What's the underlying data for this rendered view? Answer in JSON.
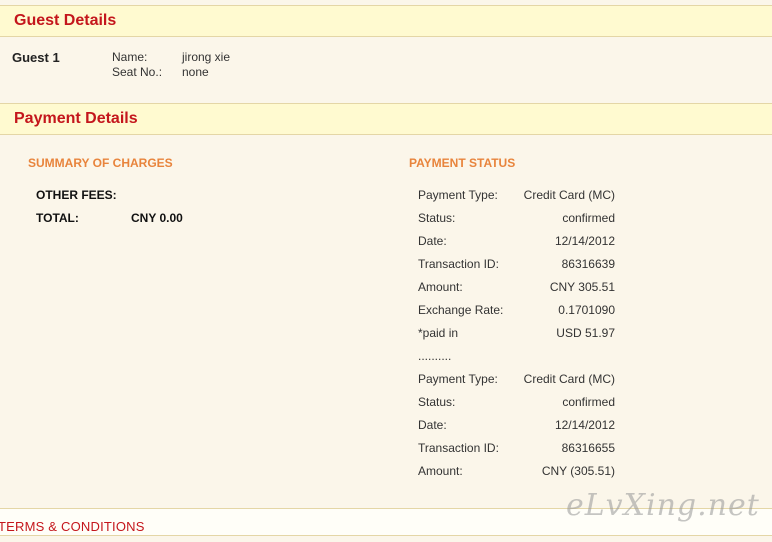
{
  "guest_details": {
    "title": "Guest Details",
    "guests": [
      {
        "label": "Guest 1",
        "name_label": "Name:",
        "name": "jirong xie",
        "seat_label": "Seat No.:",
        "seat": "none"
      }
    ]
  },
  "payment_details": {
    "title": "Payment Details",
    "summary": {
      "heading": "SUMMARY OF CHARGES",
      "other_fees_label": "OTHER FEES:",
      "total_label": "TOTAL:",
      "total_value": "CNY  0.00"
    },
    "status": {
      "heading": "PAYMENT STATUS",
      "rows": [
        {
          "k": "Payment Type:",
          "v": "Credit Card (MC)"
        },
        {
          "k": "Status:",
          "v": "confirmed"
        },
        {
          "k": "Date:",
          "v": "12/14/2012"
        },
        {
          "k": "Transaction ID:",
          "v": "86316639"
        },
        {
          "k": "Amount:",
          "v": "CNY 305.51"
        },
        {
          "k": "Exchange Rate:",
          "v": "0.1701090"
        },
        {
          "k": "*paid in",
          "v": "USD 51.97"
        },
        {
          "k": "..........",
          "v": ""
        },
        {
          "k": "Payment Type:",
          "v": "Credit Card (MC)"
        },
        {
          "k": "Status:",
          "v": "confirmed"
        },
        {
          "k": "Date:",
          "v": "12/14/2012"
        },
        {
          "k": "Transaction ID:",
          "v": "86316655"
        },
        {
          "k": "Amount:",
          "v": "CNY (305.51)"
        }
      ]
    }
  },
  "terms": {
    "title": "TERMS & CONDITIONS"
  },
  "watermark": "eLvXing.net"
}
